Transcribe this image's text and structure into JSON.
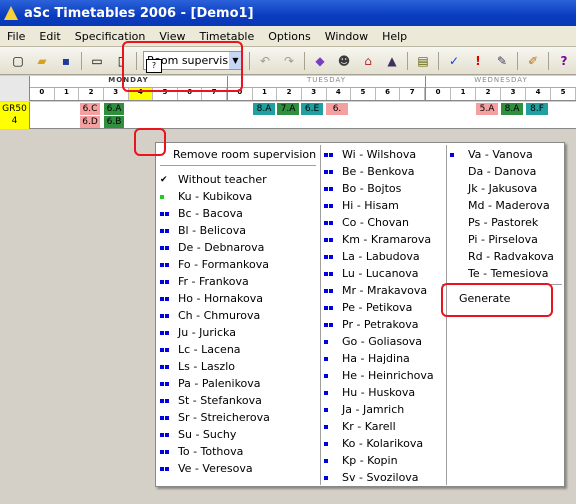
{
  "window": {
    "title": "aSc Timetables 2006  - [Demo1]"
  },
  "menus": [
    "File",
    "Edit",
    "Specification",
    "View",
    "Timetable",
    "Options",
    "Window",
    "Help"
  ],
  "toolbar": {
    "mode_value": "Room supervision"
  },
  "grid": {
    "days": [
      "MONDAY",
      "TUESDAY",
      "WEDNESDAY"
    ],
    "periods": [
      "0",
      "1",
      "2",
      "3",
      "4",
      "5",
      "6",
      "7"
    ],
    "class_name": "GR50",
    "class_count": "4",
    "monday_lessons": [
      "6.C",
      "6.A",
      "6.D",
      "6.B"
    ],
    "tuesday_lessons": [
      "8.A",
      "7.A",
      "6.E",
      "6."
    ],
    "wednesday_lessons": [
      "5.A",
      "8.A",
      "8.F"
    ],
    "marker_text": "?"
  },
  "popup": {
    "remove_label": "Remove room supervision",
    "without_teacher": "Without teacher",
    "col1": [
      "Ku - Kubikova",
      "Bc - Bacova",
      "Bl - Belicova",
      "De - Debnarova",
      "Fo - Formankova",
      "Fr - Frankova",
      "Ho - Hornakova",
      "Ch - Chmurova",
      "Ju - Juricka",
      "Lc - Lacena",
      "Ls - Laszlo",
      "Pa - Palenikova",
      "St - Stefankova",
      "Sr - Streicherova",
      "Su - Suchy",
      "To - Tothova",
      "Ve - Veresova"
    ],
    "col2": [
      "Wi - Wilshova",
      "Be - Benkova",
      "Bo - Bojtos",
      "Hi - Hisam",
      "Co - Chovan",
      "Km - Kramarova",
      "La - Labudova",
      "Lu - Lucanova",
      "Mr - Mrakavova",
      "Pe - Petikova",
      "Pr - Petrakova",
      "Go - Goliasova",
      "Ha - Hajdina",
      "He - Heinrichova",
      "Hu - Huskova",
      "Ja - Jamrich",
      "Kr - Karell",
      "Ko - Kolarikova",
      "Kp - Kopin",
      "Sv - Svozilova"
    ],
    "col3": [
      "Va - Vanova",
      "Da - Danova",
      "Jk - Jakusova",
      "Md - Maderova",
      "Ps - Pastorek",
      "Pi - Pirselova",
      "Rd - Radvakova",
      "Te - Temesiova"
    ],
    "generate_label": "Generate"
  },
  "colors": {
    "highlight_box": "#e8141e",
    "class_cell": "#ffff00",
    "title_bar": "#0a3cc0"
  }
}
